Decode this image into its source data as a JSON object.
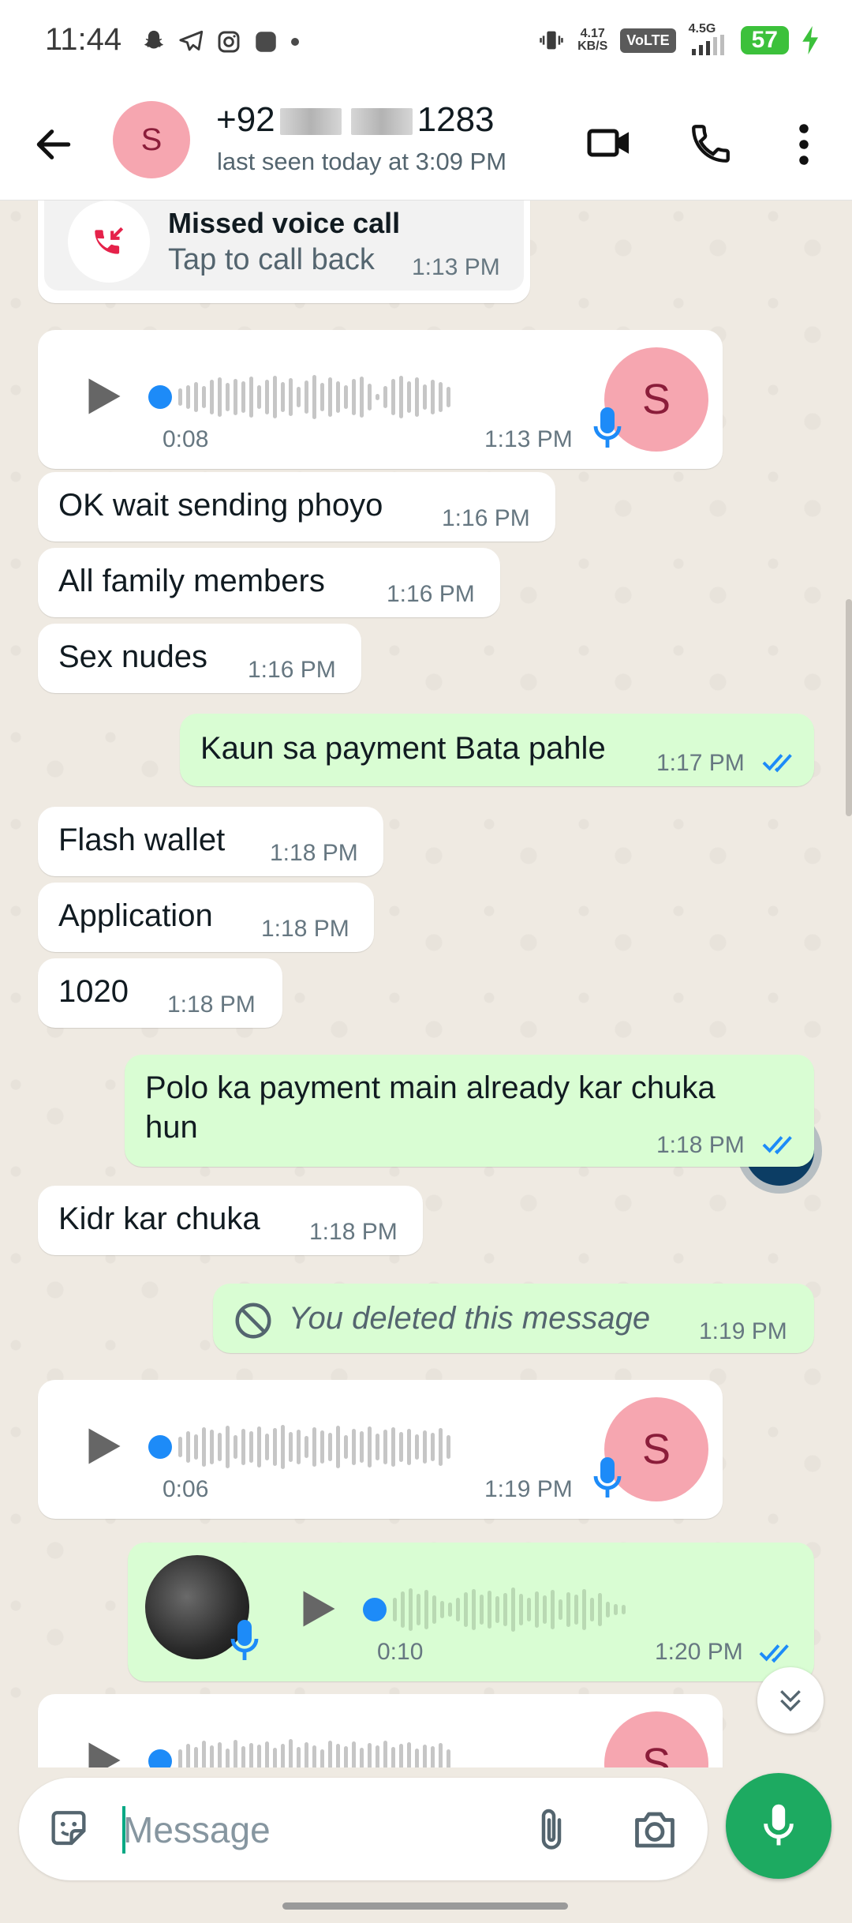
{
  "status_bar": {
    "time": "11:44",
    "net_speed_value": "4.17",
    "net_speed_unit": "KB/S",
    "volte": "VoLTE",
    "network": "4.5G",
    "battery": "57",
    "icons": [
      "snapchat-icon",
      "telegram-icon",
      "instagram-icon",
      "app-icon",
      "dot-icon",
      "vibrate-icon",
      "signal-icon",
      "charging-icon"
    ]
  },
  "header": {
    "avatar_letter": "S",
    "name_prefix": "+92",
    "name_suffix": "1283",
    "last_seen": "last seen today at 3:09 PM",
    "icons": [
      "back-arrow-icon",
      "video-call-icon",
      "voice-call-icon",
      "more-vert-icon"
    ]
  },
  "messages": {
    "missed_call": {
      "title": "Missed voice call",
      "subtitle": "Tap to call back",
      "time": "1:13 PM"
    },
    "voice1": {
      "duration": "0:08",
      "time": "1:13 PM",
      "avatar": "S"
    },
    "m1": {
      "text": "OK wait sending phoyo",
      "time": "1:16 PM"
    },
    "m2": {
      "text": "All family members",
      "time": "1:16 PM"
    },
    "m3": {
      "text": "Sex nudes",
      "time": "1:16 PM"
    },
    "m4": {
      "text": "Kaun sa payment Bata pahle",
      "time": "1:17 PM"
    },
    "m5": {
      "text": "Flash wallet",
      "time": "1:18 PM"
    },
    "m6": {
      "text": "Application",
      "time": "1:18 PM"
    },
    "m7": {
      "text": "1020",
      "time": "1:18 PM"
    },
    "m8": {
      "line1": "Polo ka payment main already kar chuka",
      "line2": "hun",
      "time": "1:18 PM"
    },
    "m9": {
      "text": "Kidr kar chuka",
      "time": "1:18 PM"
    },
    "m10": {
      "text": "You deleted this message",
      "time": "1:19 PM"
    },
    "voice2": {
      "duration": "0:06",
      "time": "1:19 PM",
      "avatar": "S"
    },
    "voice3": {
      "duration": "0:10",
      "time": "1:20 PM"
    },
    "voice4": {
      "avatar": "S"
    }
  },
  "composer": {
    "placeholder": "Message"
  },
  "colors": {
    "incoming": "#ffffff",
    "outgoing": "#d9fdd3",
    "accent": "#1daa61",
    "tick_blue": "#1d8bf8"
  }
}
